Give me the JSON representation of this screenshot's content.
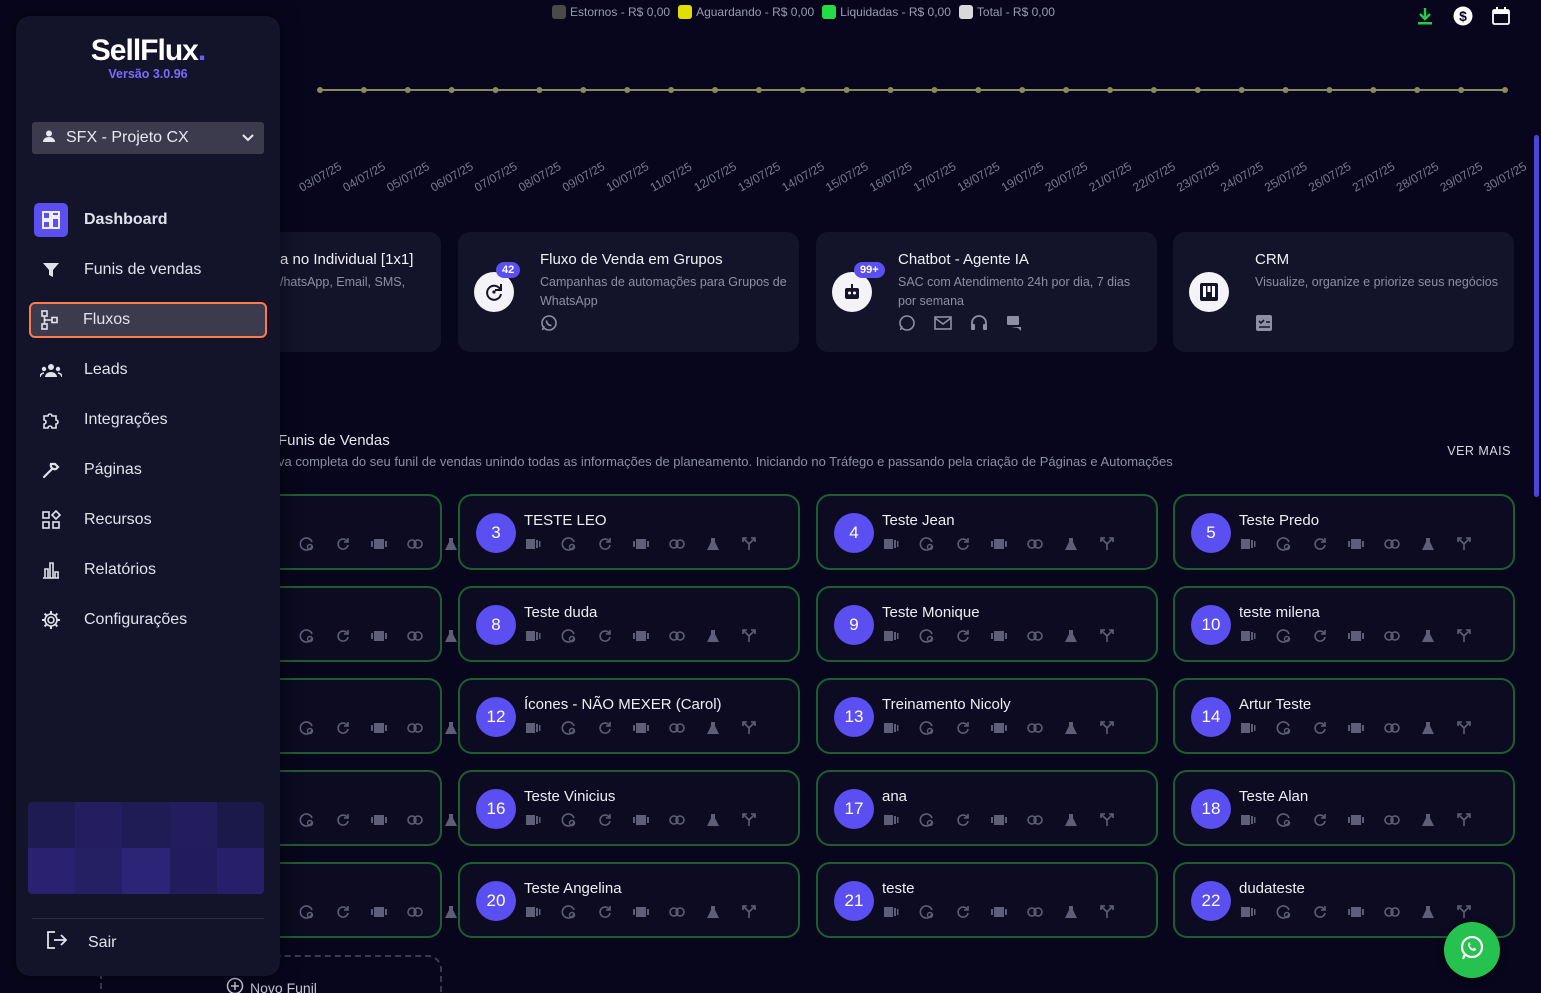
{
  "legend": [
    {
      "label": "Estornos - R$ 0,00",
      "color": "#4a4a4a"
    },
    {
      "label": "Aguardando - R$ 0,00",
      "color": "#e0e000"
    },
    {
      "label": "Liquidadas - R$ 0,00",
      "color": "#22dd44"
    },
    {
      "label": "Total - R$ 0,00",
      "color": "#d8d8d8"
    }
  ],
  "chart_data": {
    "type": "line",
    "x": [
      "03/07/25",
      "04/07/25",
      "05/07/25",
      "06/07/25",
      "07/07/25",
      "08/07/25",
      "09/07/25",
      "10/07/25",
      "11/07/25",
      "12/07/25",
      "13/07/25",
      "14/07/25",
      "15/07/25",
      "16/07/25",
      "17/07/25",
      "18/07/25",
      "19/07/25",
      "20/07/25",
      "21/07/25",
      "22/07/25",
      "23/07/25",
      "24/07/25",
      "25/07/25",
      "26/07/25",
      "27/07/25",
      "28/07/25",
      "29/07/25",
      "30/07/25"
    ],
    "series": [
      {
        "name": "Total - R$ 0,00",
        "values": [
          0,
          0,
          0,
          0,
          0,
          0,
          0,
          0,
          0,
          0,
          0,
          0,
          0,
          0,
          0,
          0,
          0,
          0,
          0,
          0,
          0,
          0,
          0,
          0,
          0,
          0,
          0,
          0
        ]
      }
    ]
  },
  "sidebar": {
    "logo": "SellFlux",
    "logo_dot": ".",
    "version": "Versão 3.0.96",
    "project": "SFX - Projeto CX",
    "nav": [
      {
        "label": "Dashboard",
        "icon": "dashboard-icon"
      },
      {
        "label": "Funis de vendas",
        "icon": "filter-icon"
      },
      {
        "label": "Fluxos",
        "icon": "flow-icon"
      },
      {
        "label": "Leads",
        "icon": "people-icon"
      },
      {
        "label": "Integrações",
        "icon": "puzzle-icon"
      },
      {
        "label": "Páginas",
        "icon": "wrench-icon"
      },
      {
        "label": "Recursos",
        "icon": "widgets-icon"
      },
      {
        "label": "Relatórios",
        "icon": "bar-chart-icon"
      },
      {
        "label": "Configurações",
        "icon": "gear-icon"
      }
    ],
    "logout": "Sair"
  },
  "products": [
    {
      "title": "a no Individual [1x1]",
      "desc": "/hatsApp, Email, SMS,",
      "badge": ""
    },
    {
      "title": "Fluxo de Venda em Grupos",
      "desc": "Campanhas de automações para Grupos de WhatsApp",
      "badge": "42"
    },
    {
      "title": "Chatbot - Agente IA",
      "desc": "SAC com Atendimento 24h por dia, 7 dias por semana",
      "badge": "99+"
    },
    {
      "title": "CRM",
      "desc": "Visualize, organize e priorize seus negócios",
      "badge": ""
    }
  ],
  "funnels_section": {
    "title": "Funis de Vendas",
    "desc": "va completa do seu funil de vendas unindo todas as informações de planeamento. Iniciando no Tráfego e passando pela criação de Páginas e Automações",
    "see_more": "VER MAIS"
  },
  "funnels": [
    {
      "num": "3",
      "name": "TESTE LEO"
    },
    {
      "num": "4",
      "name": "Teste Jean"
    },
    {
      "num": "5",
      "name": "Teste Predo"
    },
    {
      "num": "8",
      "name": "Teste duda"
    },
    {
      "num": "9",
      "name": "Teste Monique"
    },
    {
      "num": "10",
      "name": "teste milena"
    },
    {
      "num": "12",
      "name": "Ícones - NÃO MEXER (Carol)"
    },
    {
      "num": "13",
      "name": "Treinamento Nicoly"
    },
    {
      "num": "14",
      "name": "Artur Teste"
    },
    {
      "num": "16",
      "name": "Teste Vinicius"
    },
    {
      "num": "17",
      "name": "ana"
    },
    {
      "num": "18",
      "name": "Teste Alan"
    },
    {
      "num": "20",
      "name": "Teste Angelina"
    },
    {
      "num": "21",
      "name": "teste"
    },
    {
      "num": "22",
      "name": "dudateste"
    }
  ],
  "new_funnel": "Novo Funil"
}
